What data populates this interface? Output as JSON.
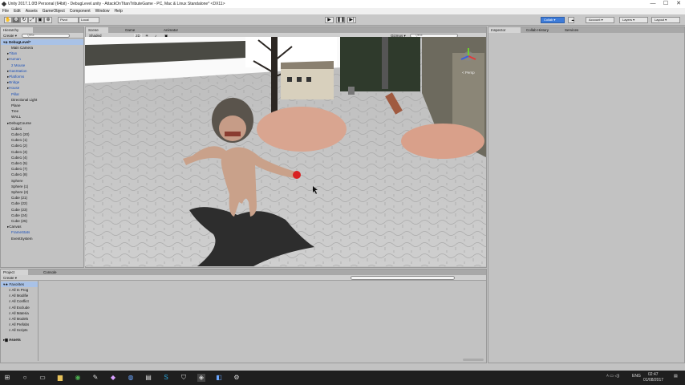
{
  "window": {
    "title": "Unity 2017.1.0f3 Personal (64bit) - DebugLevel.unity - AttackOnTitanTributeGame - PC, Mac & Linux Standalone* <DX11>",
    "controls": [
      "—",
      "☐",
      "✕"
    ]
  },
  "menu": [
    "File",
    "Edit",
    "Assets",
    "GameObject",
    "Component",
    "Window",
    "Help"
  ],
  "toolbar": {
    "pivot": "Pivot",
    "local": "Local",
    "collab": "Collab ▾",
    "account": "Account ▾",
    "layers": "Layers ▾",
    "layout": "Layout ▾"
  },
  "hierarchy": {
    "tab": "Hierarchy",
    "create": "Create ▾",
    "search_placeholder": "Q▾All",
    "scene_name": "DebugLevel*",
    "items": [
      {
        "label": "Main Camera",
        "indent": 2,
        "color": "black"
      },
      {
        "label": "Titan",
        "indent": 1,
        "color": "blue"
      },
      {
        "label": "Human",
        "indent": 1,
        "color": "blue"
      },
      {
        "label": "2 Mouse",
        "indent": 2,
        "color": "blue"
      },
      {
        "label": "GasStation",
        "indent": 1,
        "color": "blue"
      },
      {
        "label": "Platforms",
        "indent": 1,
        "color": "blue"
      },
      {
        "label": "Bridge",
        "indent": 1,
        "color": "blue"
      },
      {
        "label": "House",
        "indent": 1,
        "color": "blue"
      },
      {
        "label": "Pillar",
        "indent": 2,
        "color": "blue"
      },
      {
        "label": "Directional Light",
        "indent": 2,
        "color": "black"
      },
      {
        "label": "Plane",
        "indent": 2,
        "color": "black"
      },
      {
        "label": "Tree",
        "indent": 2,
        "color": "black"
      },
      {
        "label": "WALL",
        "indent": 2,
        "color": "black"
      },
      {
        "label": "DebugCourse",
        "indent": 1,
        "color": "black"
      },
      {
        "label": "Cube1",
        "indent": 2,
        "color": "black"
      },
      {
        "label": "Cube1 (20)",
        "indent": 2,
        "color": "black"
      },
      {
        "label": "Cube1 (1)",
        "indent": 2,
        "color": "black"
      },
      {
        "label": "Cube1 (2)",
        "indent": 2,
        "color": "black"
      },
      {
        "label": "Cube1 (3)",
        "indent": 2,
        "color": "black"
      },
      {
        "label": "Cube1 (4)",
        "indent": 2,
        "color": "black"
      },
      {
        "label": "Cube1 (5)",
        "indent": 2,
        "color": "black"
      },
      {
        "label": "Cube1 (7)",
        "indent": 2,
        "color": "black"
      },
      {
        "label": "Cube1 (8)",
        "indent": 2,
        "color": "black"
      },
      {
        "label": "Sphere",
        "indent": 2,
        "color": "black"
      },
      {
        "label": "Sphere (1)",
        "indent": 2,
        "color": "black"
      },
      {
        "label": "Sphere (2)",
        "indent": 2,
        "color": "black"
      },
      {
        "label": "Cube (21)",
        "indent": 2,
        "color": "black"
      },
      {
        "label": "Cube (22)",
        "indent": 2,
        "color": "black"
      },
      {
        "label": "Cube (23)",
        "indent": 2,
        "color": "black"
      },
      {
        "label": "Cube (24)",
        "indent": 2,
        "color": "black"
      },
      {
        "label": "Cube (25)",
        "indent": 2,
        "color": "black"
      },
      {
        "label": "Canvas",
        "indent": 1,
        "color": "black"
      },
      {
        "label": "FrameStats",
        "indent": 2,
        "color": "blue"
      },
      {
        "label": "EventSystem",
        "indent": 2,
        "color": "black"
      }
    ]
  },
  "scene": {
    "tabs": [
      "Scene",
      "Game",
      "Animator"
    ],
    "shading": "Shaded",
    "mode_2d": "2D",
    "gizmos": "Gizmos ▾",
    "search_placeholder": "Q▾All",
    "persp": "< Persp"
  },
  "inspector": {
    "tabs": [
      "Inspector",
      "Collab History",
      "Services"
    ]
  },
  "project": {
    "tabs": [
      "Project",
      "Console"
    ],
    "create": "Create ▾",
    "favorites_label": "Favorites",
    "favorites": [
      "All In Prog",
      "All Modifie",
      "All Conflict",
      "All Exclude",
      "All Materia",
      "All Models",
      "All Prefabs",
      "All Scripts"
    ],
    "assets_label": "Assets"
  },
  "taskbar": {
    "time": "02:47",
    "date": "01/08/2017",
    "lang": "ENG"
  },
  "colors": {
    "selection": "#a9c2e7",
    "prefab_text": "#1a4fb8",
    "collab_button": "#3d7bd8"
  }
}
